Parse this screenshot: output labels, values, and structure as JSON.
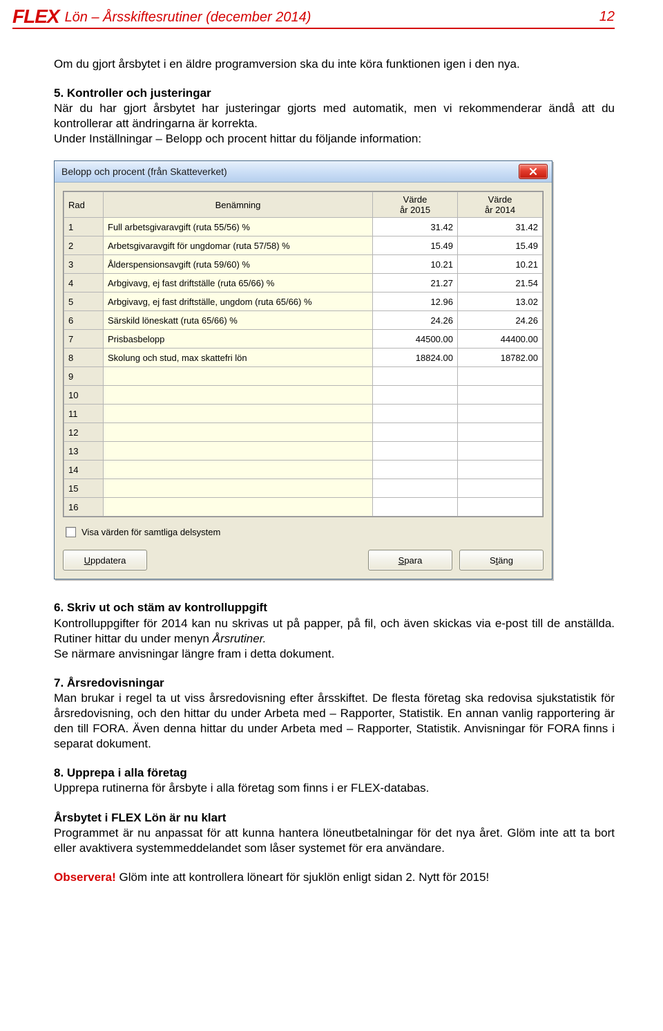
{
  "header": {
    "logo": "FLEX",
    "title": "Lön – Årsskiftesrutiner (december 2014)",
    "page_number": "12"
  },
  "text": {
    "p1": "Om du gjort årsbytet i en äldre programversion ska du inte köra funktionen igen i den nya.",
    "h5": "5. Kontroller och justeringar",
    "p5a": "När du har gjort årsbytet har justeringar gjorts med automatik, men vi rekommenderar ändå att du kontrollerar att ändringarna är korrekta.",
    "p5b": "Under Inställningar – Belopp och procent hittar du följande information:",
    "h6": "6. Skriv ut och stäm av kontrolluppgift",
    "p6a": "Kontrolluppgifter för 2014 kan nu skrivas ut på papper, på fil, och även skickas via e-post till de anställda. Rutiner hittar du under menyn ",
    "p6a_ital": "Årsrutiner.",
    "p6b": "Se närmare anvisningar längre fram i detta dokument.",
    "h7": "7. Årsredovisningar",
    "p7": "Man brukar i regel ta ut viss årsredovisning efter årsskiftet. De flesta företag ska redovisa sjukstatistik för årsredovisning, och den hittar du under Arbeta med – Rapporter, Statistik. En annan vanlig rapportering är den till FORA. Även denna hittar du under Arbeta med – Rapporter, Statistik. Anvisningar för FORA finns i separat dokument.",
    "h8": "8. Upprepa i alla företag",
    "p8": "Upprepa rutinerna för årsbyte i alla företag som finns i er FLEX-databas.",
    "h9": "Årsbytet i FLEX Lön är nu klart",
    "p9": "Programmet är nu anpassat för att kunna hantera löneutbetalningar för det nya året. Glöm inte att ta bort eller avaktivera systemmeddelandet som låser systemet för era användare.",
    "obs_label": "Observera!",
    "obs_rest": " Glöm inte att kontrollera löneart för sjuklön enligt sidan 2. Nytt för 2015!"
  },
  "window": {
    "title": "Belopp och procent (från Skatteverket)",
    "headers": {
      "rad": "Rad",
      "ben": "Benämning",
      "v2015": "Värde\når 2015",
      "v2014": "Värde\når 2014"
    },
    "rows": [
      {
        "rad": "1",
        "ben": "Full arbetsgivaravgift (ruta 55/56) %",
        "v2015": "31.42",
        "v2014": "31.42"
      },
      {
        "rad": "2",
        "ben": "Arbetsgivaravgift för ungdomar (ruta 57/58) %",
        "v2015": "15.49",
        "v2014": "15.49"
      },
      {
        "rad": "3",
        "ben": "Ålderspensionsavgift (ruta 59/60) %",
        "v2015": "10.21",
        "v2014": "10.21"
      },
      {
        "rad": "4",
        "ben": "Arbgivavg, ej fast driftställe (ruta 65/66) %",
        "v2015": "21.27",
        "v2014": "21.54"
      },
      {
        "rad": "5",
        "ben": "Arbgivavg, ej fast driftställe, ungdom (ruta 65/66) %",
        "v2015": "12.96",
        "v2014": "13.02"
      },
      {
        "rad": "6",
        "ben": "Särskild löneskatt (ruta 65/66) %",
        "v2015": "24.26",
        "v2014": "24.26"
      },
      {
        "rad": "7",
        "ben": "Prisbasbelopp",
        "v2015": "44500.00",
        "v2014": "44400.00"
      },
      {
        "rad": "8",
        "ben": "Skolung och stud, max skattefri lön",
        "v2015": "18824.00",
        "v2014": "18782.00"
      },
      {
        "rad": "9",
        "ben": "",
        "v2015": "",
        "v2014": ""
      },
      {
        "rad": "10",
        "ben": "",
        "v2015": "",
        "v2014": ""
      },
      {
        "rad": "11",
        "ben": "",
        "v2015": "",
        "v2014": ""
      },
      {
        "rad": "12",
        "ben": "",
        "v2015": "",
        "v2014": ""
      },
      {
        "rad": "13",
        "ben": "",
        "v2015": "",
        "v2014": ""
      },
      {
        "rad": "14",
        "ben": "",
        "v2015": "",
        "v2014": ""
      },
      {
        "rad": "15",
        "ben": "",
        "v2015": "",
        "v2014": ""
      },
      {
        "rad": "16",
        "ben": "",
        "v2015": "",
        "v2014": ""
      }
    ],
    "checkbox_label": "Visa värden för samtliga delsystem",
    "buttons": {
      "update_accel": "U",
      "update_rest": "ppdatera",
      "save_accel": "S",
      "save_rest": "para",
      "close_pre": "S",
      "close_accel": "t",
      "close_rest": "äng"
    }
  }
}
